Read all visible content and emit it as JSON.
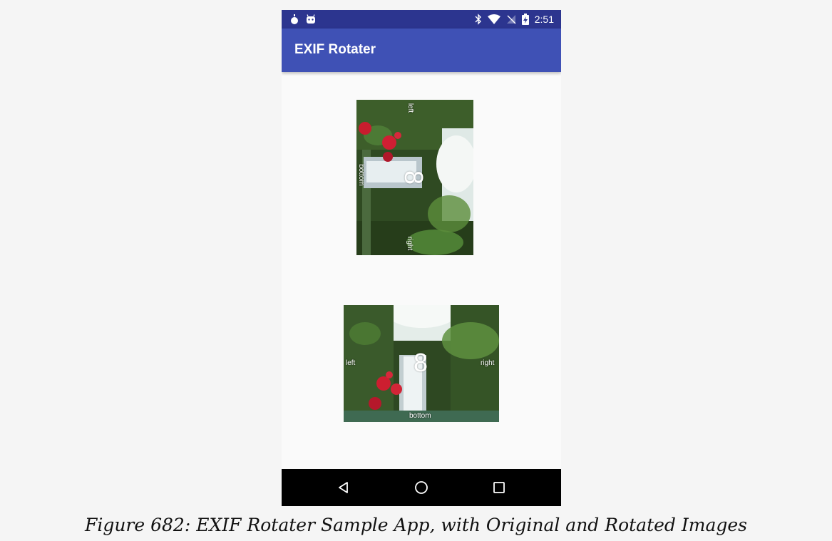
{
  "status_bar": {
    "time": "2:51",
    "left_icons": [
      "notification-drop-icon",
      "android-robot-icon"
    ],
    "right_icons": [
      "bluetooth-icon",
      "wifi-icon",
      "no-sim-icon",
      "battery-charging-icon"
    ]
  },
  "app_bar": {
    "title": "EXIF Rotater"
  },
  "original_image": {
    "digit": "8",
    "labels": {
      "top": "left",
      "bottom": "right",
      "left": "bottom"
    }
  },
  "rotated_image": {
    "digit": "8",
    "labels": {
      "left": "left",
      "right": "right",
      "bottom": "bottom"
    }
  },
  "nav_bar": {
    "buttons": [
      "back-icon",
      "home-icon",
      "recents-icon"
    ]
  },
  "caption": "Figure 682: EXIF Rotater Sample App, with Original and Rotated Images",
  "colors": {
    "status_bar": "#2c358f",
    "app_bar": "#3f51b5",
    "nav_bar": "#000000",
    "content_bg": "#fafafa"
  }
}
